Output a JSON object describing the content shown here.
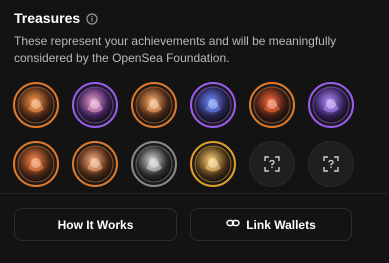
{
  "header": {
    "title": "Treasures",
    "info_icon": "info-icon"
  },
  "description": "These represent your achievements and will be meaningfully considered by the OpenSea Foundation.",
  "badges": [
    {
      "name": "treasure-badge-1",
      "ring": "#e07a2a",
      "fill": "#4a2614",
      "accent": "#ff9a4a"
    },
    {
      "name": "treasure-badge-2",
      "ring": "#9b5cf0",
      "fill": "#3a1f57",
      "accent": "#f0a0d0"
    },
    {
      "name": "treasure-badge-3",
      "ring": "#e07a2a",
      "fill": "#4a2614",
      "accent": "#ffb070"
    },
    {
      "name": "treasure-badge-4",
      "ring": "#9b5cf0",
      "fill": "#26204a",
      "accent": "#6a8cff"
    },
    {
      "name": "treasure-badge-5",
      "ring": "#e07a2a",
      "fill": "#3a1a12",
      "accent": "#ff6a3a"
    },
    {
      "name": "treasure-badge-6",
      "ring": "#9b5cf0",
      "fill": "#2f1e55",
      "accent": "#b58cff"
    },
    {
      "name": "treasure-badge-7",
      "ring": "#e07a2a",
      "fill": "#4a2614",
      "accent": "#ff8a4a"
    },
    {
      "name": "treasure-badge-8",
      "ring": "#e07a2a",
      "fill": "#4a2614",
      "accent": "#ffb080"
    },
    {
      "name": "treasure-badge-9",
      "ring": "#8a8a8a",
      "fill": "#2a2a2a",
      "accent": "#d8d8d8"
    },
    {
      "name": "treasure-badge-10",
      "ring": "#e0a02a",
      "fill": "#4a3214",
      "accent": "#ffd27a"
    }
  ],
  "empty_slots": 2,
  "buttons": {
    "how_label": "How It Works",
    "link_label": "Link Wallets"
  },
  "colors": {
    "background": "#131313",
    "border": "#2c2c2c",
    "text": "#ffffff",
    "muted": "#b9b9b9"
  }
}
